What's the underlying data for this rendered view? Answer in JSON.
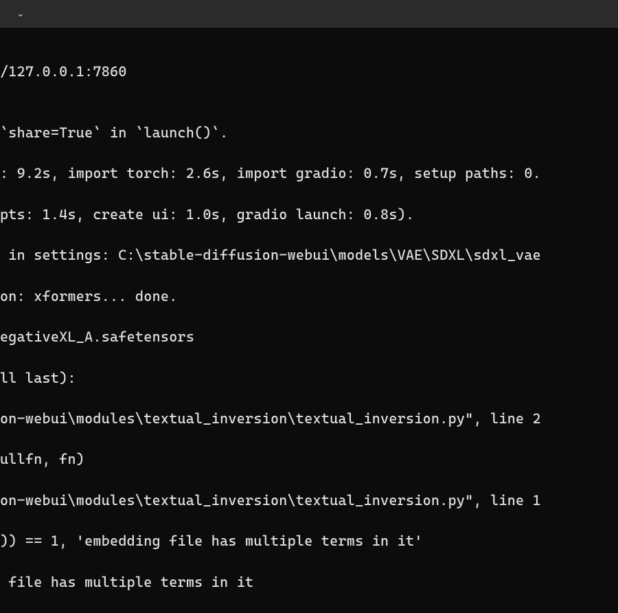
{
  "titlebar": {
    "dropdown_icon": "⌄"
  },
  "terminal": {
    "lines": [
      "/127.0.0.1:7860",
      "",
      "`share=True` in `launch()`.",
      ": 9.2s, import torch: 2.6s, import gradio: 0.7s, setup paths: 0.",
      "pts: 1.4s, create ui: 1.0s, gradio launch: 0.8s).",
      " in settings: C:\\stable-diffusion-webui\\models\\VAE\\SDXL\\sdxl_vae",
      "on: xformers... done.",
      "egativeXL_A.safetensors",
      "ll last):",
      "on-webui\\modules\\textual_inversion\\textual_inversion.py\", line 2",
      "ullfn, fn)",
      "on-webui\\modules\\textual_inversion\\textual_inversion.py\", line 1",
      ")) == 1, 'embedding file has multiple terms in it'",
      " file has multiple terms in it"
    ]
  }
}
